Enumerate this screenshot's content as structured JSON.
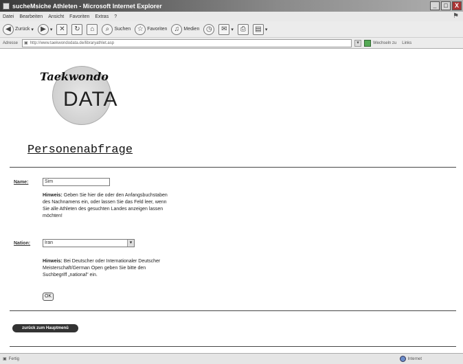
{
  "window": {
    "title": "sucheMsiche Athleten - Microsoft Internet Explorer",
    "btn_min": "_",
    "btn_max": "□",
    "btn_close": "X"
  },
  "menu": {
    "items": [
      "Datei",
      "Bearbeiten",
      "Ansicht",
      "Favoriten",
      "Extras",
      "?"
    ]
  },
  "toolbar": {
    "back_label": "Zurück",
    "search_label": "Suchen",
    "favorites_label": "Favoriten",
    "media_label": "Medien"
  },
  "address": {
    "label": "Adresse",
    "url": "http://www.taekwondodata.de/libraryathlet.asp",
    "go_label": "Wechseln zu",
    "links_label": "Links"
  },
  "logo": {
    "top_text": "Taekwondo",
    "main_text": "DATA"
  },
  "page": {
    "title": "Personenabfrage",
    "name_label": "Name:",
    "name_value": "Sim",
    "name_hint_bold": "Hinweis:",
    "name_hint_lines": [
      "Geben Sie hier die oder den Anfangsbuchstaben",
      "des Nachnamens ein, oder lassen Sie das Feld leer, wenn",
      "Sie alle Athleten des gesuchten Landes anzeigen lassen",
      "möchten!"
    ],
    "nation_label": "Nation:",
    "nation_value": "Iran",
    "nation_hint_bold": "Hinweis:",
    "nation_hint_lines": [
      "Bei Deutscher oder Internationaler Deutscher",
      "Meisterschaft/German Open geben Sie bitte den",
      "Suchbegriff „national\" ein."
    ],
    "ok_label": "OK",
    "back_label": "zurück zum Hauptmenü"
  },
  "status": {
    "left": "Fertig",
    "zone": "Internet"
  }
}
